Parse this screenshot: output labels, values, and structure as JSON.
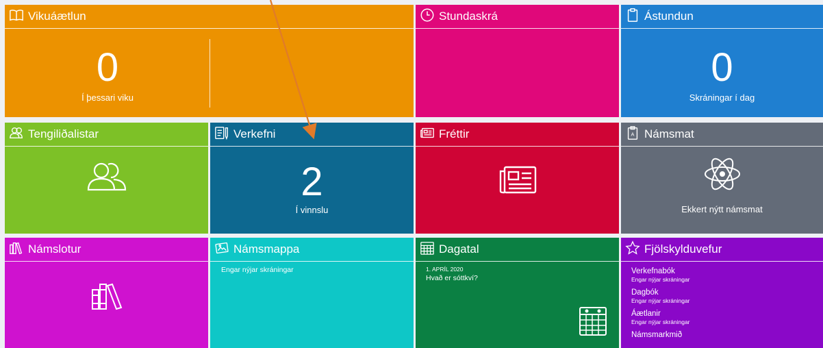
{
  "colors": {
    "vikuaaetlun": "#ec9200",
    "stundaskra": "#e0087a",
    "astundun": "#1f7fd0",
    "tengilidalistar": "#7dc127",
    "verkefni": "#0d6890",
    "frettir": "#cf0435",
    "namsmat": "#636b78",
    "namslotur": "#cf12cf",
    "namsmappa": "#0ec7c7",
    "dagatal": "#0b8043",
    "fjolskylduvefur": "#8a08c8",
    "annotation_arrow": "#e07b2a"
  },
  "tiles": {
    "vikuaaetlun": {
      "title": "Vikuáætlun",
      "icon": "book-icon",
      "count": "0",
      "caption": "Í þessari viku"
    },
    "stundaskra": {
      "title": "Stundaskrá",
      "icon": "clock-icon"
    },
    "astundun": {
      "title": "Ástundun",
      "icon": "clipboard-icon",
      "count": "0",
      "caption": "Skráningar í dag"
    },
    "tengilidalistar": {
      "title": "Tengiliðalistar",
      "icon": "users-icon"
    },
    "verkefni": {
      "title": "Verkefni",
      "icon": "document-pencil-icon",
      "count": "2",
      "caption": "Í vinnslu"
    },
    "frettir": {
      "title": "Fréttir",
      "icon": "newspaper-icon"
    },
    "namsmat": {
      "title": "Námsmat",
      "icon": "grade-clipboard-icon",
      "caption": "Ekkert nýtt námsmat"
    },
    "namslotur": {
      "title": "Námslotur",
      "icon": "library-books-icon"
    },
    "namsmappa": {
      "title": "Námsmappa",
      "icon": "photo-folder-icon",
      "empty": "Engar nýjar skráningar"
    },
    "dagatal": {
      "title": "Dagatal",
      "icon": "calendar-icon",
      "event_date": "1. APRÍL 2020",
      "event_title": "Hvað er sóttkví?"
    },
    "fjolskylduvefur": {
      "title": "Fjölskylduvefur",
      "icon": "star-icon",
      "items": [
        {
          "title": "Verkefnabók",
          "sub": "Engar nýjar skráningar"
        },
        {
          "title": "Dagbók",
          "sub": "Engar nýjar skráningar"
        },
        {
          "title": "Áætlanir",
          "sub": "Engar nýjar skráningar"
        },
        {
          "title": "Námsmarkmið",
          "sub": ""
        }
      ]
    }
  }
}
